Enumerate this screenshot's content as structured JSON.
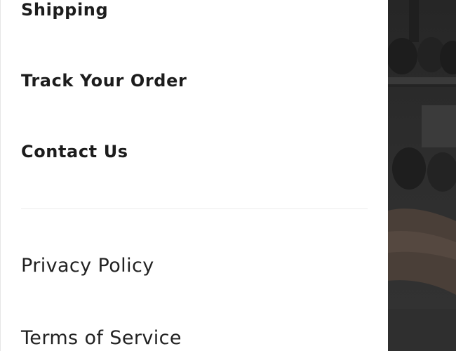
{
  "menu": {
    "primary_links": [
      {
        "label": "Shipping"
      },
      {
        "label": "Track Your Order"
      },
      {
        "label": "Contact Us"
      }
    ],
    "secondary_links": [
      {
        "label": "Privacy Policy"
      },
      {
        "label": "Terms of Service"
      }
    ]
  },
  "colors": {
    "text": "#1c1c1c",
    "divider": "#ececec",
    "background": "#ffffff",
    "backdrop": "#2b2b2b"
  }
}
